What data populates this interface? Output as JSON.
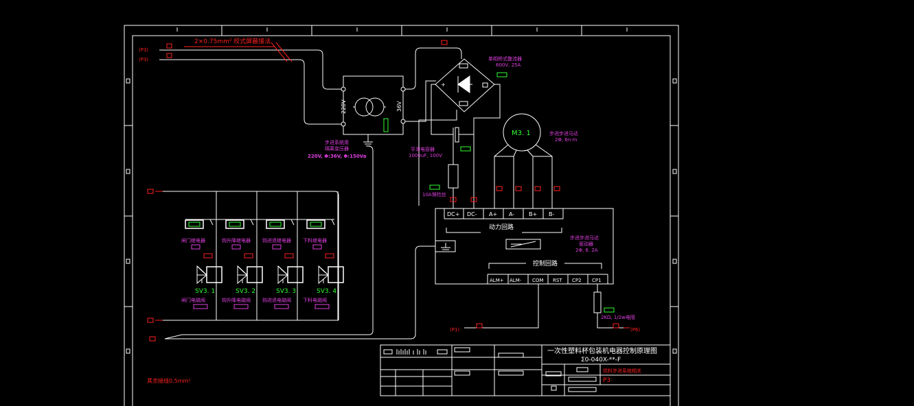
{
  "colors": {
    "background": "#000000",
    "line": "#ffffff",
    "red": "#ff2020",
    "magenta": "#e040e0",
    "green": "#30ff30",
    "yellow": "#ffff40"
  },
  "wires": {
    "twisted_pair": "2×0.75mm² 绞式屏蔽接法",
    "p3_a": "(P3)",
    "p3_b": "(P3)",
    "p1": "(P1)",
    "p6": "(P6)"
  },
  "transformer": {
    "primary_v": "220V",
    "secondary_v": "36V",
    "label_1": "步进系统用",
    "label_2": "隔离变压器",
    "spec": "220V, Φ:36V, Φ:150Va"
  },
  "rectifier": {
    "label_1": "单相桥式整流器",
    "label_2": "600V, 25A"
  },
  "capacitor": {
    "label_1": "平滑电容器",
    "label_2": "1000uF, 100V"
  },
  "fuse": {
    "label": "10A保险丝"
  },
  "motor": {
    "tag": "M3. 1",
    "label_1": "步进步进马达",
    "label_2": "2Φ, 6n·m"
  },
  "driver": {
    "terminals_top": [
      "DC+",
      "DC-",
      "A+",
      "A-",
      "B+",
      "B-"
    ],
    "power_circuit": "动力回路",
    "control_circuit": "控制回路",
    "terminals_bottom": [
      "ALM+",
      "ALM-",
      "COM",
      "RST",
      "CP2",
      "CP1"
    ],
    "label_1": "步进步进马达",
    "label_2": "驱动器",
    "label_3": "2Φ, 6. 2A"
  },
  "resistor": {
    "label": "2KΩ, 1/2w电阻"
  },
  "relays": [
    {
      "label": "闸门继电器",
      "valve_tag": "SV3. 1",
      "valve_name": "闸门电磁阀"
    },
    {
      "label": "钩升降继电器",
      "valve_tag": "SV3. 2",
      "valve_name": "钩升降电磁阀"
    },
    {
      "label": "钩进退继电器",
      "valve_tag": "SV3. 3",
      "valve_name": "钩进退电磁阀"
    },
    {
      "label": "下料继电器",
      "valve_tag": "SV3. 4",
      "valve_name": "下料电磁阀"
    }
  ],
  "note": "其余接线0.5mm²",
  "title_block": {
    "title": "一次性塑料杯包装机电器控制原理图",
    "code": "Σ0-040X-**-F",
    "subtitle": "供料步进系统相关",
    "sheet": "P3"
  }
}
